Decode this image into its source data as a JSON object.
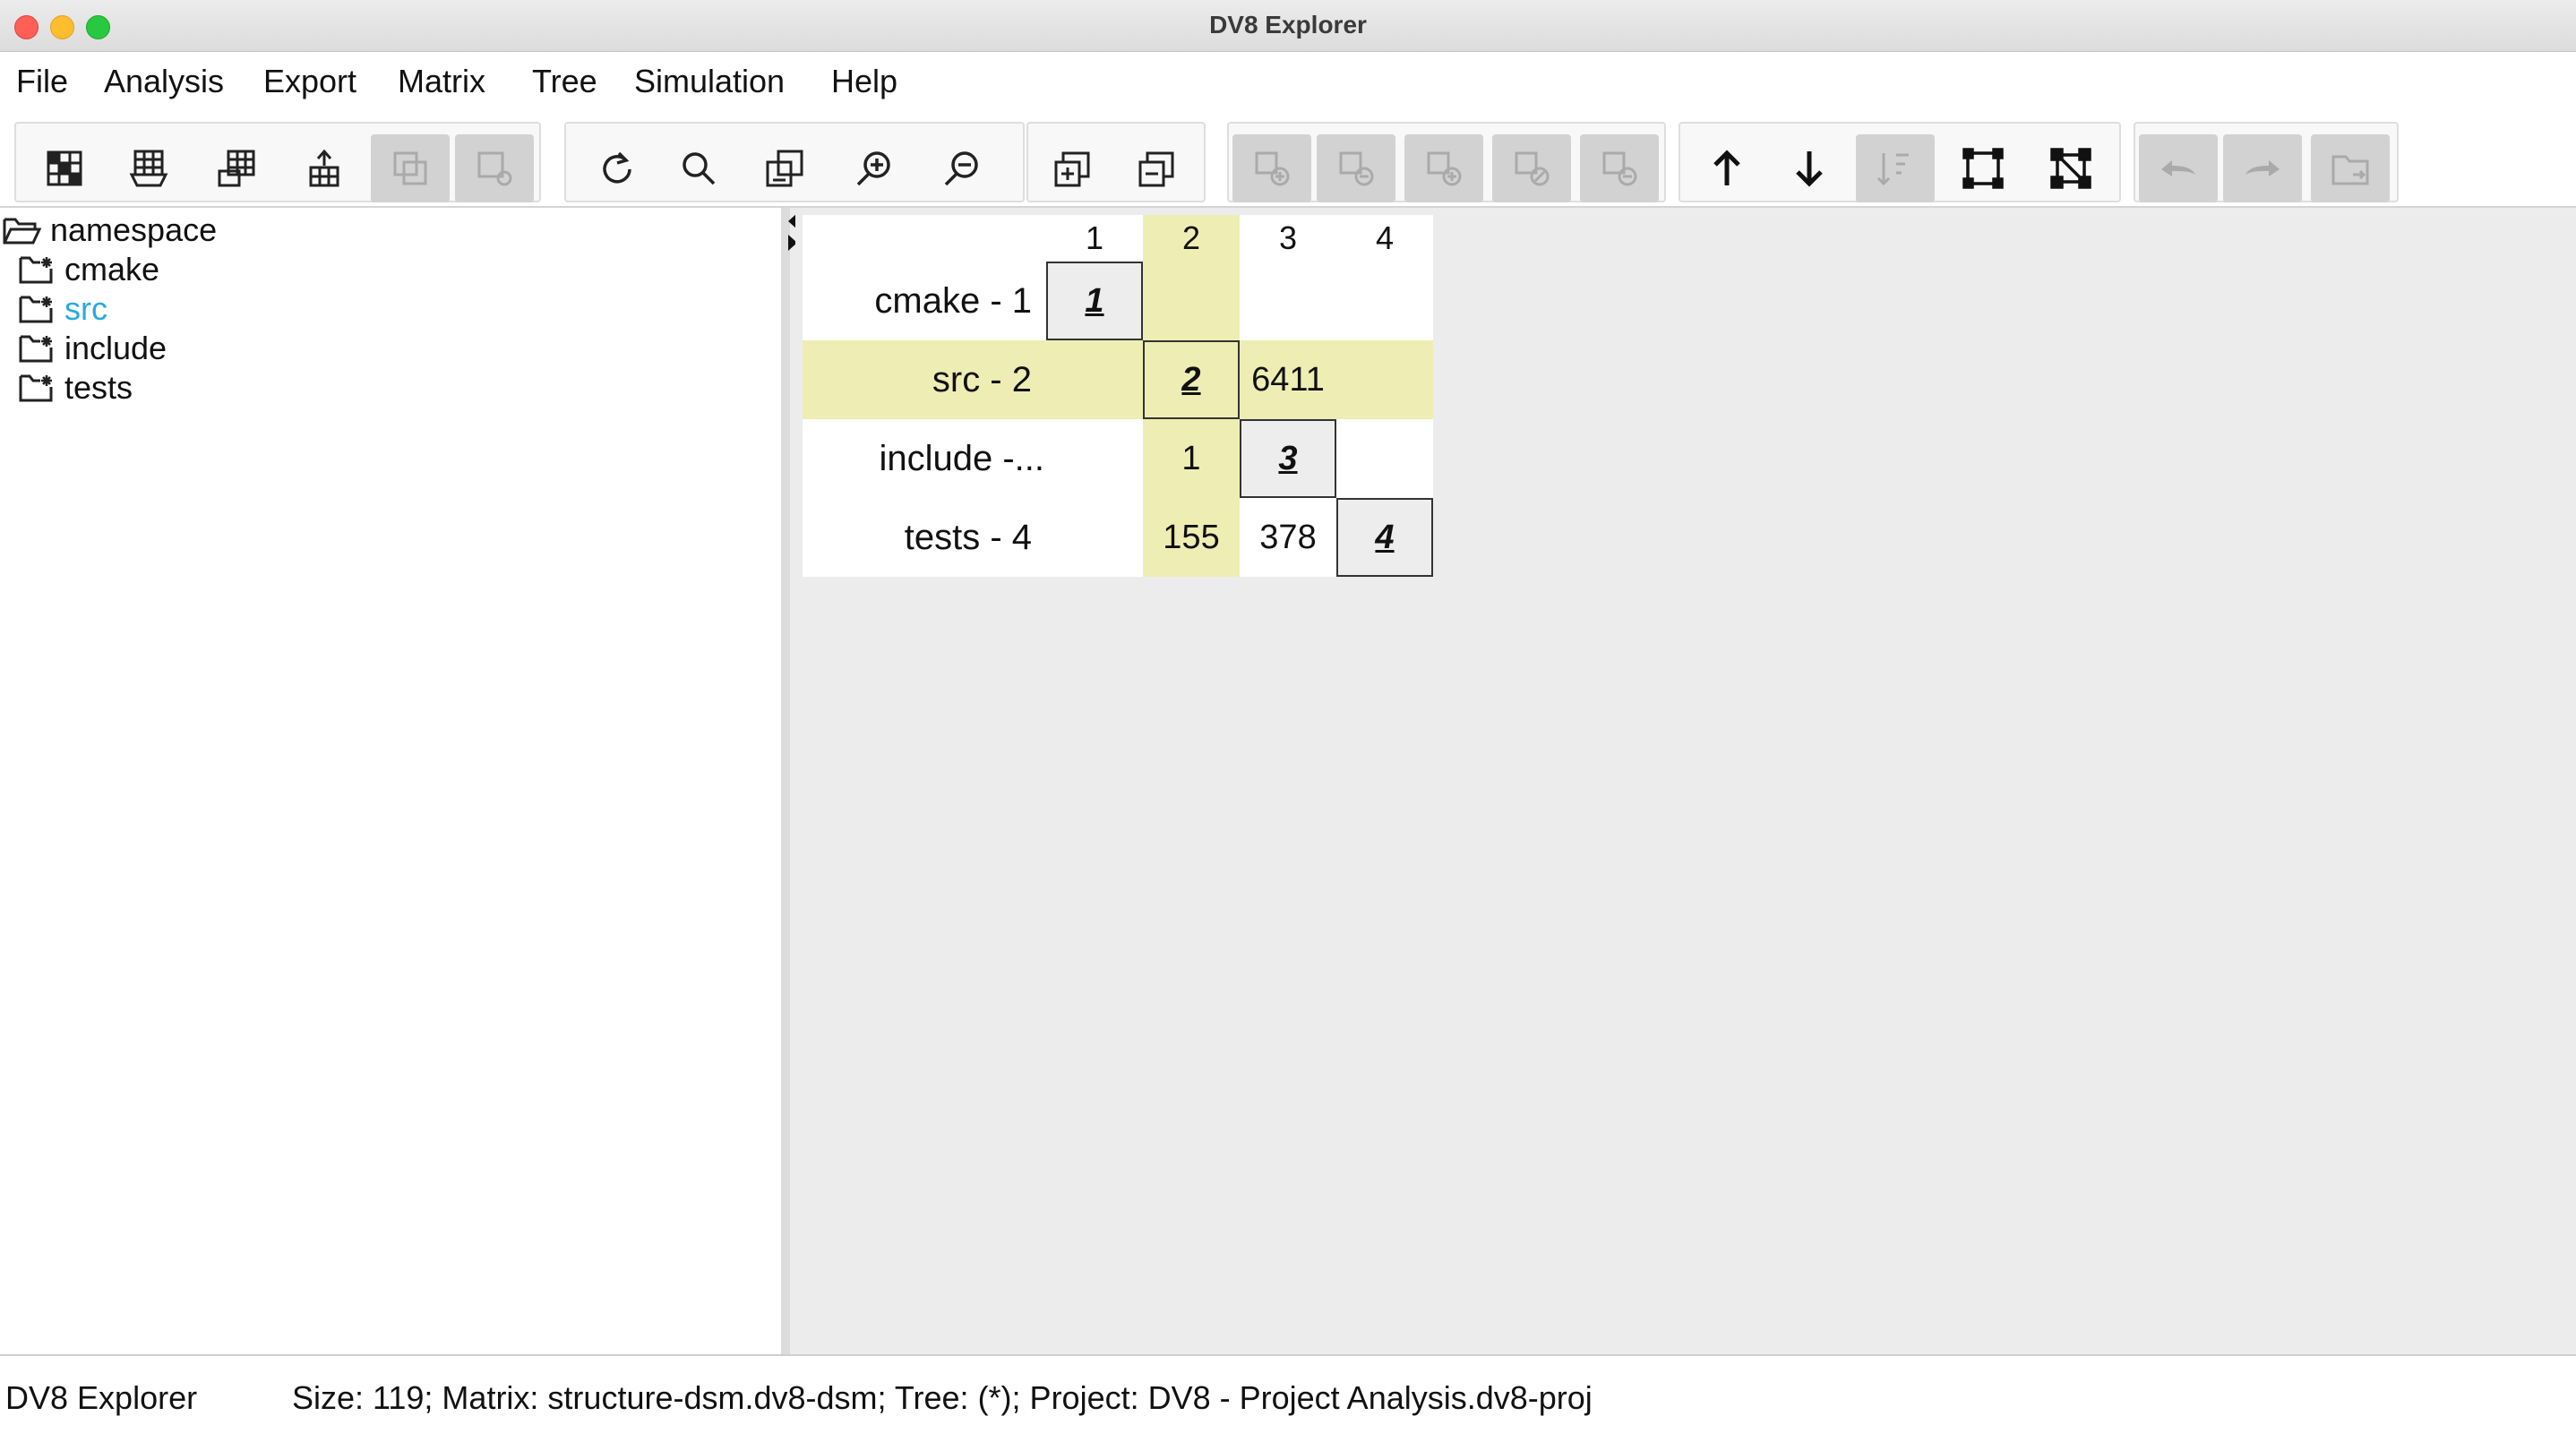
{
  "window": {
    "title": "DV8 Explorer"
  },
  "menu": [
    "File",
    "Analysis",
    "Export",
    "Matrix",
    "Tree",
    "Simulation",
    "Help"
  ],
  "toolbar": {
    "groups": [
      {
        "buttons": [
          {
            "icon": "grid-matrix-icon",
            "enabled": true
          },
          {
            "icon": "open-matrix-icon",
            "enabled": true
          },
          {
            "icon": "stack-matrix-icon",
            "enabled": true
          },
          {
            "icon": "export-matrix-icon",
            "enabled": true
          },
          {
            "icon": "matrix-disabled-icon",
            "enabled": false
          },
          {
            "icon": "matrix-settings-icon",
            "enabled": false
          }
        ]
      },
      {
        "buttons": [
          {
            "icon": "refresh-icon",
            "enabled": true
          },
          {
            "icon": "search-icon",
            "enabled": true
          },
          {
            "icon": "fit-view-icon",
            "enabled": true
          },
          {
            "icon": "zoom-in-icon",
            "enabled": true
          },
          {
            "icon": "zoom-out-icon",
            "enabled": true
          }
        ]
      },
      {
        "buttons": [
          {
            "icon": "expand-all-icon",
            "enabled": true
          },
          {
            "icon": "collapse-all-icon",
            "enabled": true
          }
        ]
      },
      {
        "buttons": [
          {
            "icon": "add-node-icon",
            "enabled": false
          },
          {
            "icon": "remove-node-icon",
            "enabled": false
          },
          {
            "icon": "add-group-icon",
            "enabled": false
          },
          {
            "icon": "edit-group-icon",
            "enabled": false
          },
          {
            "icon": "delete-group-icon",
            "enabled": false
          }
        ]
      },
      {
        "buttons": [
          {
            "icon": "arrow-up-icon",
            "enabled": true
          },
          {
            "icon": "arrow-down-icon",
            "enabled": true
          },
          {
            "icon": "sort-tree-icon",
            "enabled": false
          },
          {
            "icon": "select-region-icon",
            "enabled": true
          },
          {
            "icon": "network-graph-icon",
            "enabled": true
          }
        ]
      },
      {
        "buttons": [
          {
            "icon": "undo-icon",
            "enabled": false
          },
          {
            "icon": "redo-icon",
            "enabled": false
          },
          {
            "icon": "folder-link-icon",
            "enabled": false
          }
        ]
      }
    ]
  },
  "tree": {
    "root": "namespace",
    "children": [
      {
        "label": "cmake",
        "selected": false
      },
      {
        "label": "src",
        "selected": true
      },
      {
        "label": "include",
        "selected": false
      },
      {
        "label": "tests",
        "selected": false
      }
    ]
  },
  "matrix": {
    "columns": [
      "1",
      "2",
      "3",
      "4"
    ],
    "rows": [
      {
        "label": "cmake - 1",
        "cells": [
          "1",
          "",
          "",
          ""
        ]
      },
      {
        "label": "src - 2",
        "cells": [
          "",
          "2",
          "6411",
          ""
        ]
      },
      {
        "label": "include -...",
        "cells": [
          "",
          "1",
          "3",
          ""
        ]
      },
      {
        "label": "tests - 4",
        "cells": [
          "",
          "155",
          "378",
          "4"
        ]
      }
    ],
    "highlight": {
      "row": 1,
      "column": 1
    },
    "highlight_color": "#eeeeb4"
  },
  "status": {
    "app": "DV8 Explorer",
    "info": "Size: 119; Matrix: structure-dsm.dv8-dsm; Tree: (*); Project: DV8 - Project Analysis.dv8-proj"
  },
  "colors": {
    "selected_tree_item": "#29a8e0"
  }
}
